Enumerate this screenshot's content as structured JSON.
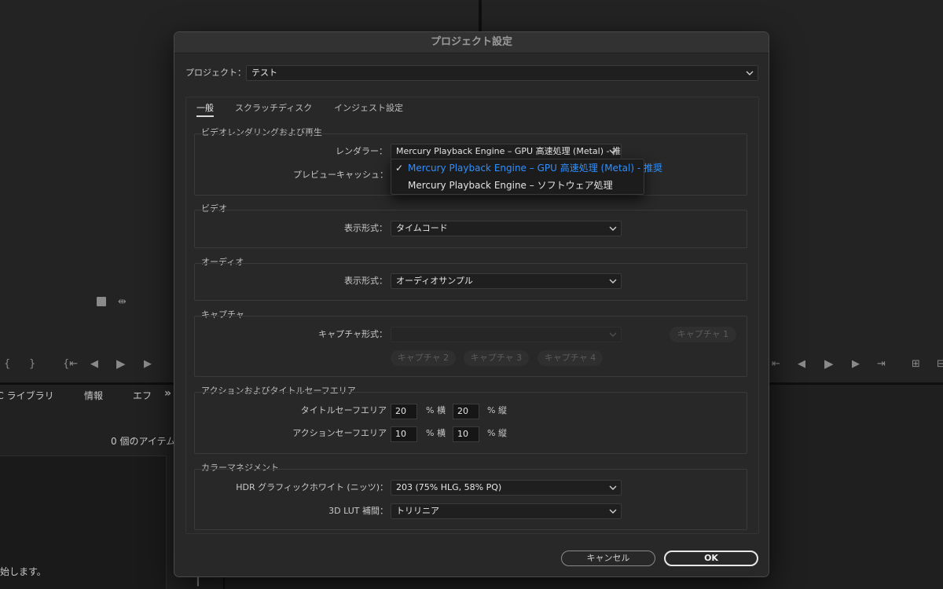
{
  "background": {
    "library_tabs": [
      "CC ライブラリ",
      "情報",
      "エフ"
    ],
    "library_overflow": "»",
    "item_count": "0 個のアイテム",
    "hint_text": "始します。"
  },
  "dialog": {
    "title": "プロジェクト設定",
    "project_label": "プロジェクト：",
    "project_value": "テスト",
    "tabs": [
      "一般",
      "スクラッチディスク",
      "インジェスト設定"
    ],
    "active_tab": "一般",
    "sections": {
      "rendering": {
        "title": "ビデオレンダリングおよび再生",
        "renderer_label": "レンダラー：",
        "renderer_value": "Mercury Playback Engine – GPU 高速処理 (Metal) - 推奨",
        "preview_cache_label": "プレビューキャッシュ："
      },
      "video": {
        "title": "ビデオ",
        "display_format_label": "表示形式：",
        "display_format_value": "タイムコード"
      },
      "audio": {
        "title": "オーディオ",
        "display_format_label": "表示形式：",
        "display_format_value": "オーディオサンプル"
      },
      "capture": {
        "title": "キャプチャ",
        "capture_format_label": "キャプチャ形式：",
        "capture_buttons": [
          "キャプチャ 1",
          "キャプチャ 2",
          "キャプチャ 3",
          "キャプチャ 4"
        ]
      },
      "safe_areas": {
        "title": "アクションおよびタイトルセーフエリア",
        "title_safe_label": "タイトルセーフエリア",
        "title_safe_h": "20",
        "title_safe_v": "20",
        "action_safe_label": "アクションセーフエリア",
        "action_safe_h": "10",
        "action_safe_v": "10",
        "unit_h": "% 横",
        "unit_v": "% 縦"
      },
      "color": {
        "title": "カラーマネジメント",
        "hdr_label": "HDR グラフィックホワイト (ニッツ)：",
        "hdr_value": "203 (75% HLG, 58% PQ)",
        "lut_label": "3D LUT 補間：",
        "lut_value": "トリリニア"
      }
    },
    "renderer_dropdown": {
      "options": [
        {
          "label": "Mercury Playback Engine – GPU 高速処理 (Metal) - 推奨",
          "selected": true
        },
        {
          "label": "Mercury Playback Engine – ソフトウェア処理",
          "selected": false
        }
      ]
    },
    "cancel_label": "キャンセル",
    "ok_label": "OK"
  },
  "colors": {
    "selected_option": "#2f90ff",
    "dialog_bg": "#282828"
  }
}
